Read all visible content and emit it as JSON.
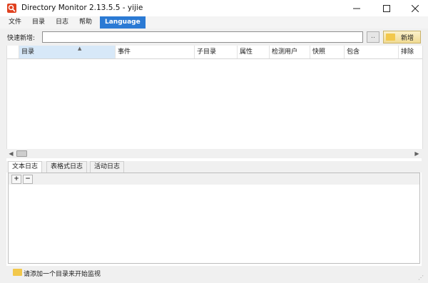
{
  "window": {
    "title": "Directory Monitor 2.13.5.5 - yijie"
  },
  "menu": [
    {
      "label": "文件"
    },
    {
      "label": "目录"
    },
    {
      "label": "日志"
    },
    {
      "label": "帮助"
    },
    {
      "label": "Language"
    }
  ],
  "quickbar": {
    "label": "快速新增:",
    "input_value": "",
    "browse_label": "..",
    "add_label": "新增"
  },
  "table": {
    "columns": [
      "目录",
      "事件",
      "子目录",
      "属性",
      "检测用户",
      "快照",
      "包含",
      "排除"
    ],
    "rows": []
  },
  "tabs": [
    {
      "label": "文本日志",
      "active": true
    },
    {
      "label": "表格式日志",
      "active": false
    },
    {
      "label": "活动日志",
      "active": false
    }
  ],
  "log": {
    "expand_label": "+",
    "collapse_label": "−"
  },
  "status": {
    "text": "请添加一个目录来开始监视"
  },
  "colors": {
    "accent": "#2b7ad4",
    "app_icon": "#e0411f",
    "folder": "#f2c84b"
  }
}
